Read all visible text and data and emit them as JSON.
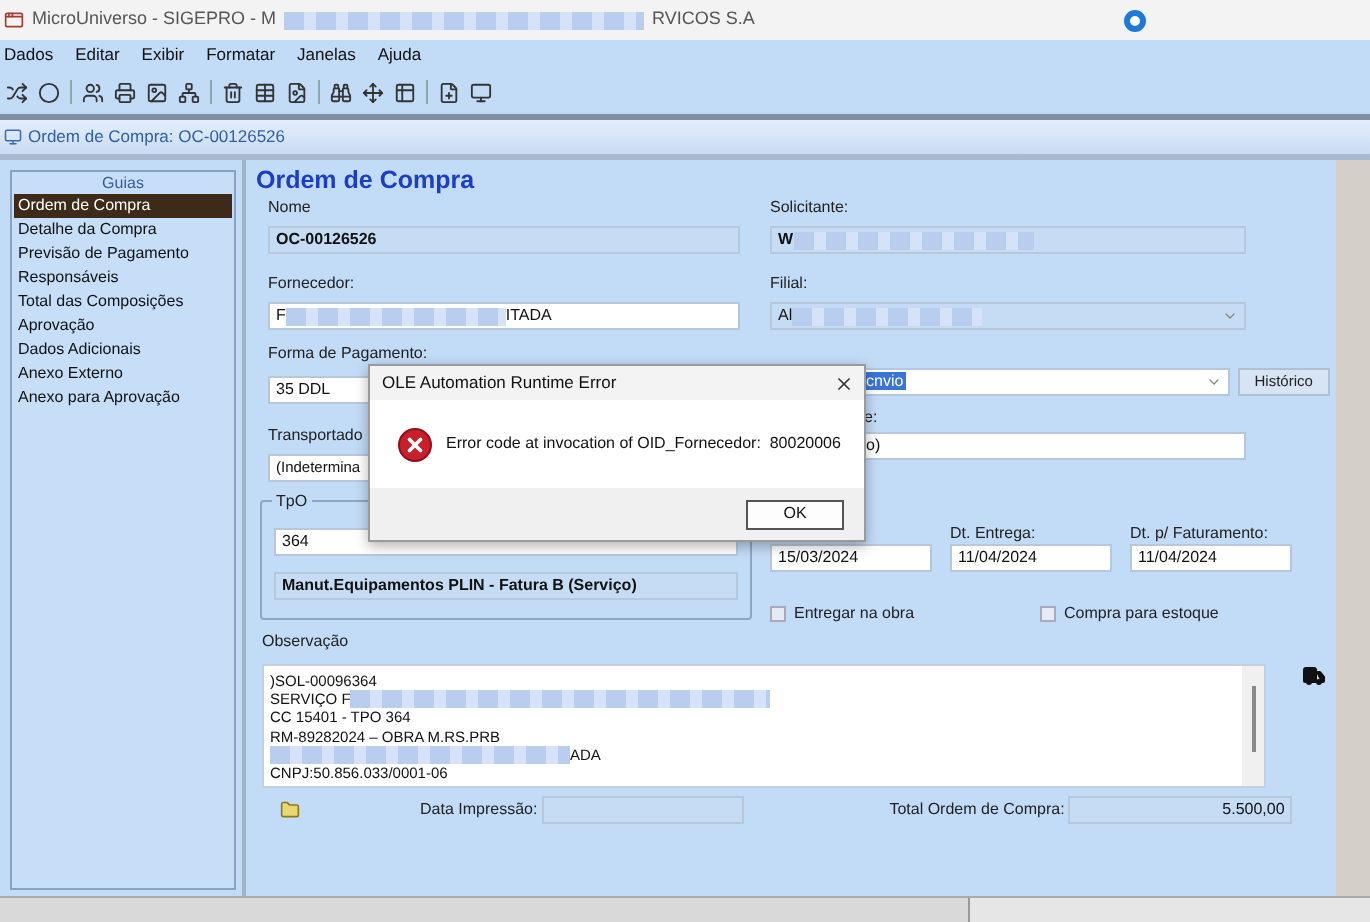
{
  "window": {
    "title_before": "MicroUniverso - SIGEPRO - M",
    "title_redacted": true,
    "title_after": "RVICOS S.A"
  },
  "menu": [
    "Dados",
    "Editar",
    "Exibir",
    "Formatar",
    "Janelas",
    "Ajuda"
  ],
  "document_title": "Ordem de Compra: OC-00126526",
  "guides": {
    "title": "Guias",
    "items": [
      {
        "label": "Ordem de Compra",
        "selected": true
      },
      {
        "label": "Detalhe da Compra",
        "selected": false
      },
      {
        "label": "Previsão de Pagamento",
        "selected": false
      },
      {
        "label": "Responsáveis",
        "selected": false
      },
      {
        "label": "Total das Composições",
        "selected": false
      },
      {
        "label": "Aprovação",
        "selected": false
      },
      {
        "label": "Dados Adicionais",
        "selected": false
      },
      {
        "label": "Anexo Externo",
        "selected": false
      },
      {
        "label": "Anexo para Aprovação",
        "selected": false
      }
    ]
  },
  "form": {
    "heading": "Ordem de Compra",
    "nome": {
      "label": "Nome",
      "value": "OC-00126526"
    },
    "solicitante": {
      "label": "Solicitante:",
      "value": "W",
      "redacted": true
    },
    "fornecedor": {
      "label": "Fornecedor:",
      "value_before": "F",
      "redacted": true,
      "value_after": "ITADA"
    },
    "filial": {
      "label": "Filial:",
      "value": "Al",
      "redacted": true
    },
    "forma_pagamento": {
      "label": "Forma de Pagamento:",
      "value": "35 DDL"
    },
    "situacao": {
      "value": "cnvio",
      "button": "Histórico"
    },
    "transportador": {
      "label": "Transportado",
      "value": "(Indetermina"
    },
    "right_field_2": {
      "label": "e:",
      "value": "o)"
    },
    "tpo": {
      "label": "TpO",
      "code": "364",
      "description": "Manut.Equipamentos PLIN - Fatura B (Serviço)"
    },
    "dates": [
      {
        "value": "15/03/2024"
      },
      {
        "label": "Dt. Entrega:",
        "value": "11/04/2024"
      },
      {
        "label": "Dt. p/ Faturamento:",
        "value": "11/04/2024"
      }
    ],
    "checkboxes": [
      {
        "label": "Entregar na obra",
        "checked": false
      },
      {
        "label": "Compra para estoque",
        "checked": false
      }
    ],
    "observacao": {
      "label": "Observação",
      "lines": [
        {
          "before": ")SOL-00096364",
          "redacted": false
        },
        {
          "before": "SERVIÇO F",
          "redacted": true
        },
        {
          "before": "CC 15401 - TPO 364",
          "redacted": false
        },
        {
          "before": "RM-89282024 – OBRA M.RS.PRB",
          "redacted": false
        },
        {
          "redacted": true,
          "after": "ADA"
        },
        {
          "before": "CNPJ:50.856.033/0001-06",
          "redacted": false
        }
      ]
    },
    "data_impressao": {
      "label": "Data Impressão:"
    },
    "total": {
      "label": "Total Ordem de Compra:",
      "value": "5.500,00"
    }
  },
  "dialog": {
    "title": "OLE Automation Runtime Error",
    "message": "Error code at invocation of OID_Fornecedor:  80020006",
    "button": "OK"
  }
}
